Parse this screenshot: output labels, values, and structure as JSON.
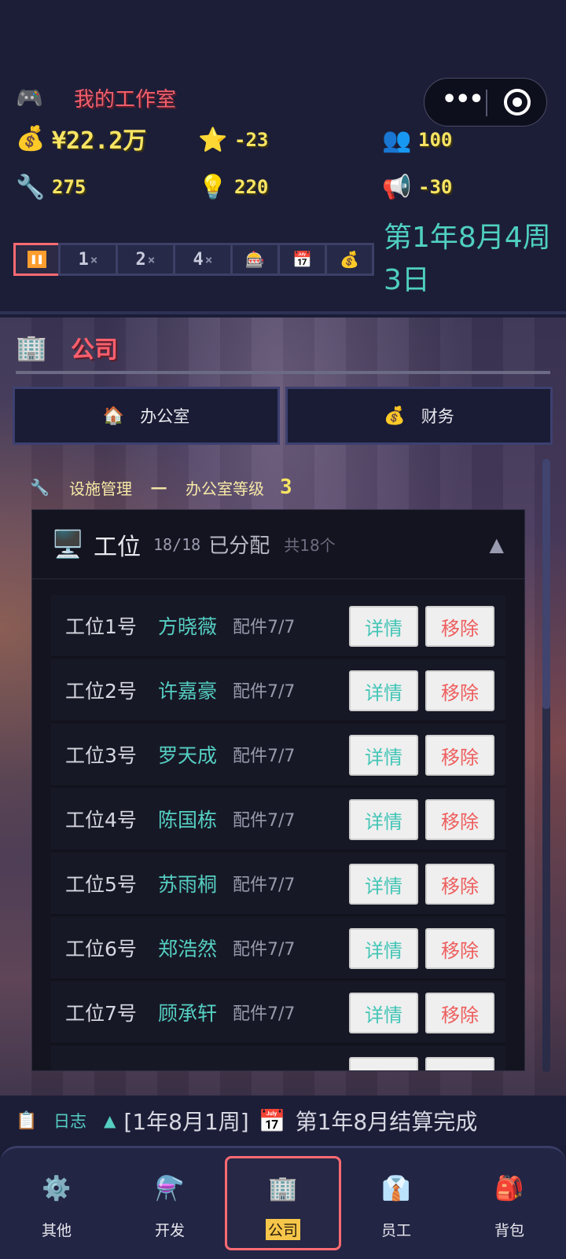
{
  "header": {
    "studio_icon": "gamepad-icon",
    "studio_name": "我的工作室",
    "stats": {
      "money": "¥22.2万",
      "reputation": "-23",
      "fans": "100",
      "tech": "275",
      "idea": "220",
      "marketing": "-30"
    },
    "speed": {
      "pause_icon": "pause-icon",
      "x1": "1",
      "x2": "2",
      "x4": "4",
      "times": "×"
    },
    "date": "第1年8月4周3日"
  },
  "company": {
    "title": "公司",
    "tabs": {
      "office": "办公室",
      "finance": "财务"
    },
    "facility_label": "设施管理",
    "facility_dash": "一",
    "office_level_label": "办公室等级",
    "office_level": "3"
  },
  "seats": {
    "title": "工位",
    "count": "18/18",
    "assigned": "已分配",
    "total": "共18个",
    "collapse_icon": "▲",
    "detail_label": "详情",
    "remove_label": "移除",
    "rows": [
      {
        "seat": "工位1号",
        "employee": "方晓薇",
        "parts": "配件7/7"
      },
      {
        "seat": "工位2号",
        "employee": "许嘉豪",
        "parts": "配件7/7"
      },
      {
        "seat": "工位3号",
        "employee": "罗天成",
        "parts": "配件7/7"
      },
      {
        "seat": "工位4号",
        "employee": "陈国栋",
        "parts": "配件7/7"
      },
      {
        "seat": "工位5号",
        "employee": "苏雨桐",
        "parts": "配件7/7"
      },
      {
        "seat": "工位6号",
        "employee": "郑浩然",
        "parts": "配件7/7"
      },
      {
        "seat": "工位7号",
        "employee": "顾承轩",
        "parts": "配件7/7"
      }
    ]
  },
  "log": {
    "label": "日志",
    "date": "[1年8月1周]",
    "message": "第1年8月结算完成"
  },
  "nav": {
    "other": "其他",
    "develop": "开发",
    "company": "公司",
    "staff": "员工",
    "bag": "背包"
  }
}
